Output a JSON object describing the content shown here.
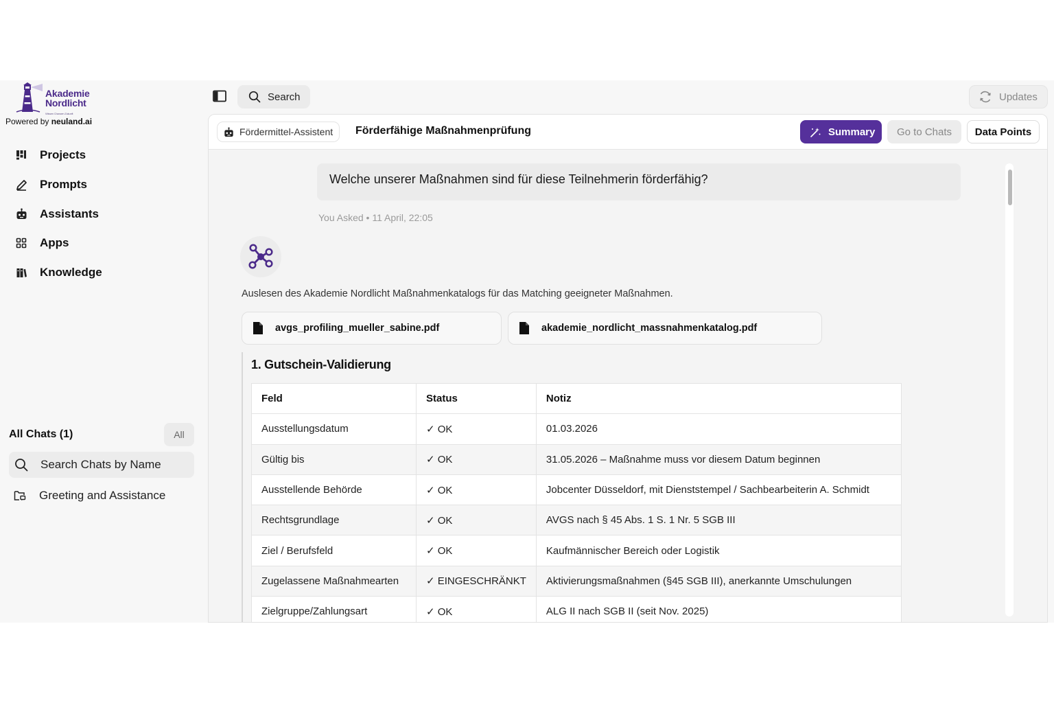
{
  "brand": {
    "name_line1": "Akademie",
    "name_line2": "Nordlicht",
    "tagline": "Wissen Chancen Zukunft",
    "powered_prefix": "Powered by",
    "powered_name": "neuland.ai",
    "color": "#4b2a8a"
  },
  "sidebar": {
    "nav": [
      {
        "label": "Projects",
        "icon": "projects-icon"
      },
      {
        "label": "Prompts",
        "icon": "pencil-icon"
      },
      {
        "label": "Assistants",
        "icon": "robot-icon"
      },
      {
        "label": "Apps",
        "icon": "grid-icon"
      },
      {
        "label": "Knowledge",
        "icon": "books-icon"
      }
    ],
    "chats_title": "All Chats (1)",
    "all_label": "All",
    "search_placeholder": "Search Chats by Name",
    "chats": [
      {
        "label": "Greeting and Assistance"
      }
    ]
  },
  "topbar": {
    "search_label": "Search",
    "updates_label": "Updates"
  },
  "header": {
    "assistant_label": "Fördermittel-Assistent",
    "title": "Förderfähige Maßnahmenprüfung",
    "summary_label": "Summary",
    "go_to_chats_label": "Go to Chats",
    "data_points_label": "Data Points",
    "accent": "#55309b"
  },
  "conversation": {
    "question": "Welche unserer Maßnahmen sind für diese Teilnehmerin förderfähig?",
    "asked_meta": "You Asked • 11 April, 22:05",
    "answer_intro": "Auslesen des Akademie Nordlicht Maßnahmenkatalogs für das Matching geeigneter Maßnahmen.",
    "files": [
      {
        "name": "avgs_profiling_mueller_sabine.pdf"
      },
      {
        "name": "akademie_nordlicht_massnahmenkatalog.pdf"
      }
    ],
    "section_title": "1. Gutschein-Validierung",
    "table": {
      "headers": [
        "Feld",
        "Status",
        "Notiz"
      ],
      "rows": [
        [
          "Ausstellungsdatum",
          "✓ OK",
          "01.03.2026"
        ],
        [
          "Gültig bis",
          "✓ OK",
          "31.05.2026 – Maßnahme muss vor diesem Datum beginnen"
        ],
        [
          "Ausstellende Behörde",
          "✓ OK",
          "Jobcenter Düsseldorf, mit Dienststempel / Sachbearbeiterin A. Schmidt"
        ],
        [
          "Rechtsgrundlage",
          "✓ OK",
          "AVGS nach § 45 Abs. 1 S. 1 Nr. 5 SGB III"
        ],
        [
          "Ziel / Berufsfeld",
          "✓ OK",
          "Kaufmännischer Bereich oder Logistik"
        ],
        [
          "Zugelassene Maßnahmearten",
          "✓ EINGESCHRÄNKT",
          "Aktivierungsmaßnahmen (§45 SGB III), anerkannte Umschulungen"
        ],
        [
          "Zielgruppe/Zahlungsart",
          "✓ OK",
          "ALG II nach SGB II (seit Nov. 2025)"
        ]
      ]
    }
  }
}
